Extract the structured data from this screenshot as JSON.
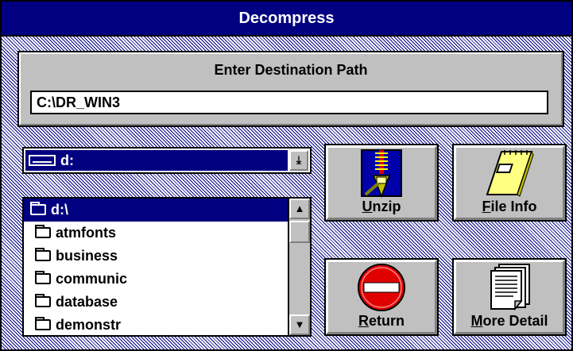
{
  "window": {
    "title": "Decompress"
  },
  "path": {
    "heading": "Enter Destination Path",
    "value": "C:\\DR_WIN3"
  },
  "drive": {
    "selected": "d:"
  },
  "directories": {
    "items": [
      {
        "label": "d:\\",
        "selected": true
      },
      {
        "label": "atmfonts"
      },
      {
        "label": "business"
      },
      {
        "label": "communic"
      },
      {
        "label": "database"
      },
      {
        "label": "demonstr"
      }
    ]
  },
  "buttons": {
    "unzip": {
      "accel": "U",
      "rest": "nzip"
    },
    "file_info": {
      "accel": "F",
      "rest": "ile Info"
    },
    "return": {
      "accel": "R",
      "rest": "eturn"
    },
    "more_detail": {
      "accel": "M",
      "rest": "ore Detail"
    }
  },
  "icons": {
    "unzip": "zipper-icon",
    "file_info": "note-pad-icon",
    "return": "no-entry-icon",
    "more_detail": "document-stack-icon"
  },
  "colors": {
    "title_bar": "#000080",
    "selection": "#000080",
    "face": "#c0c0c0",
    "no_entry": "#e00000"
  }
}
